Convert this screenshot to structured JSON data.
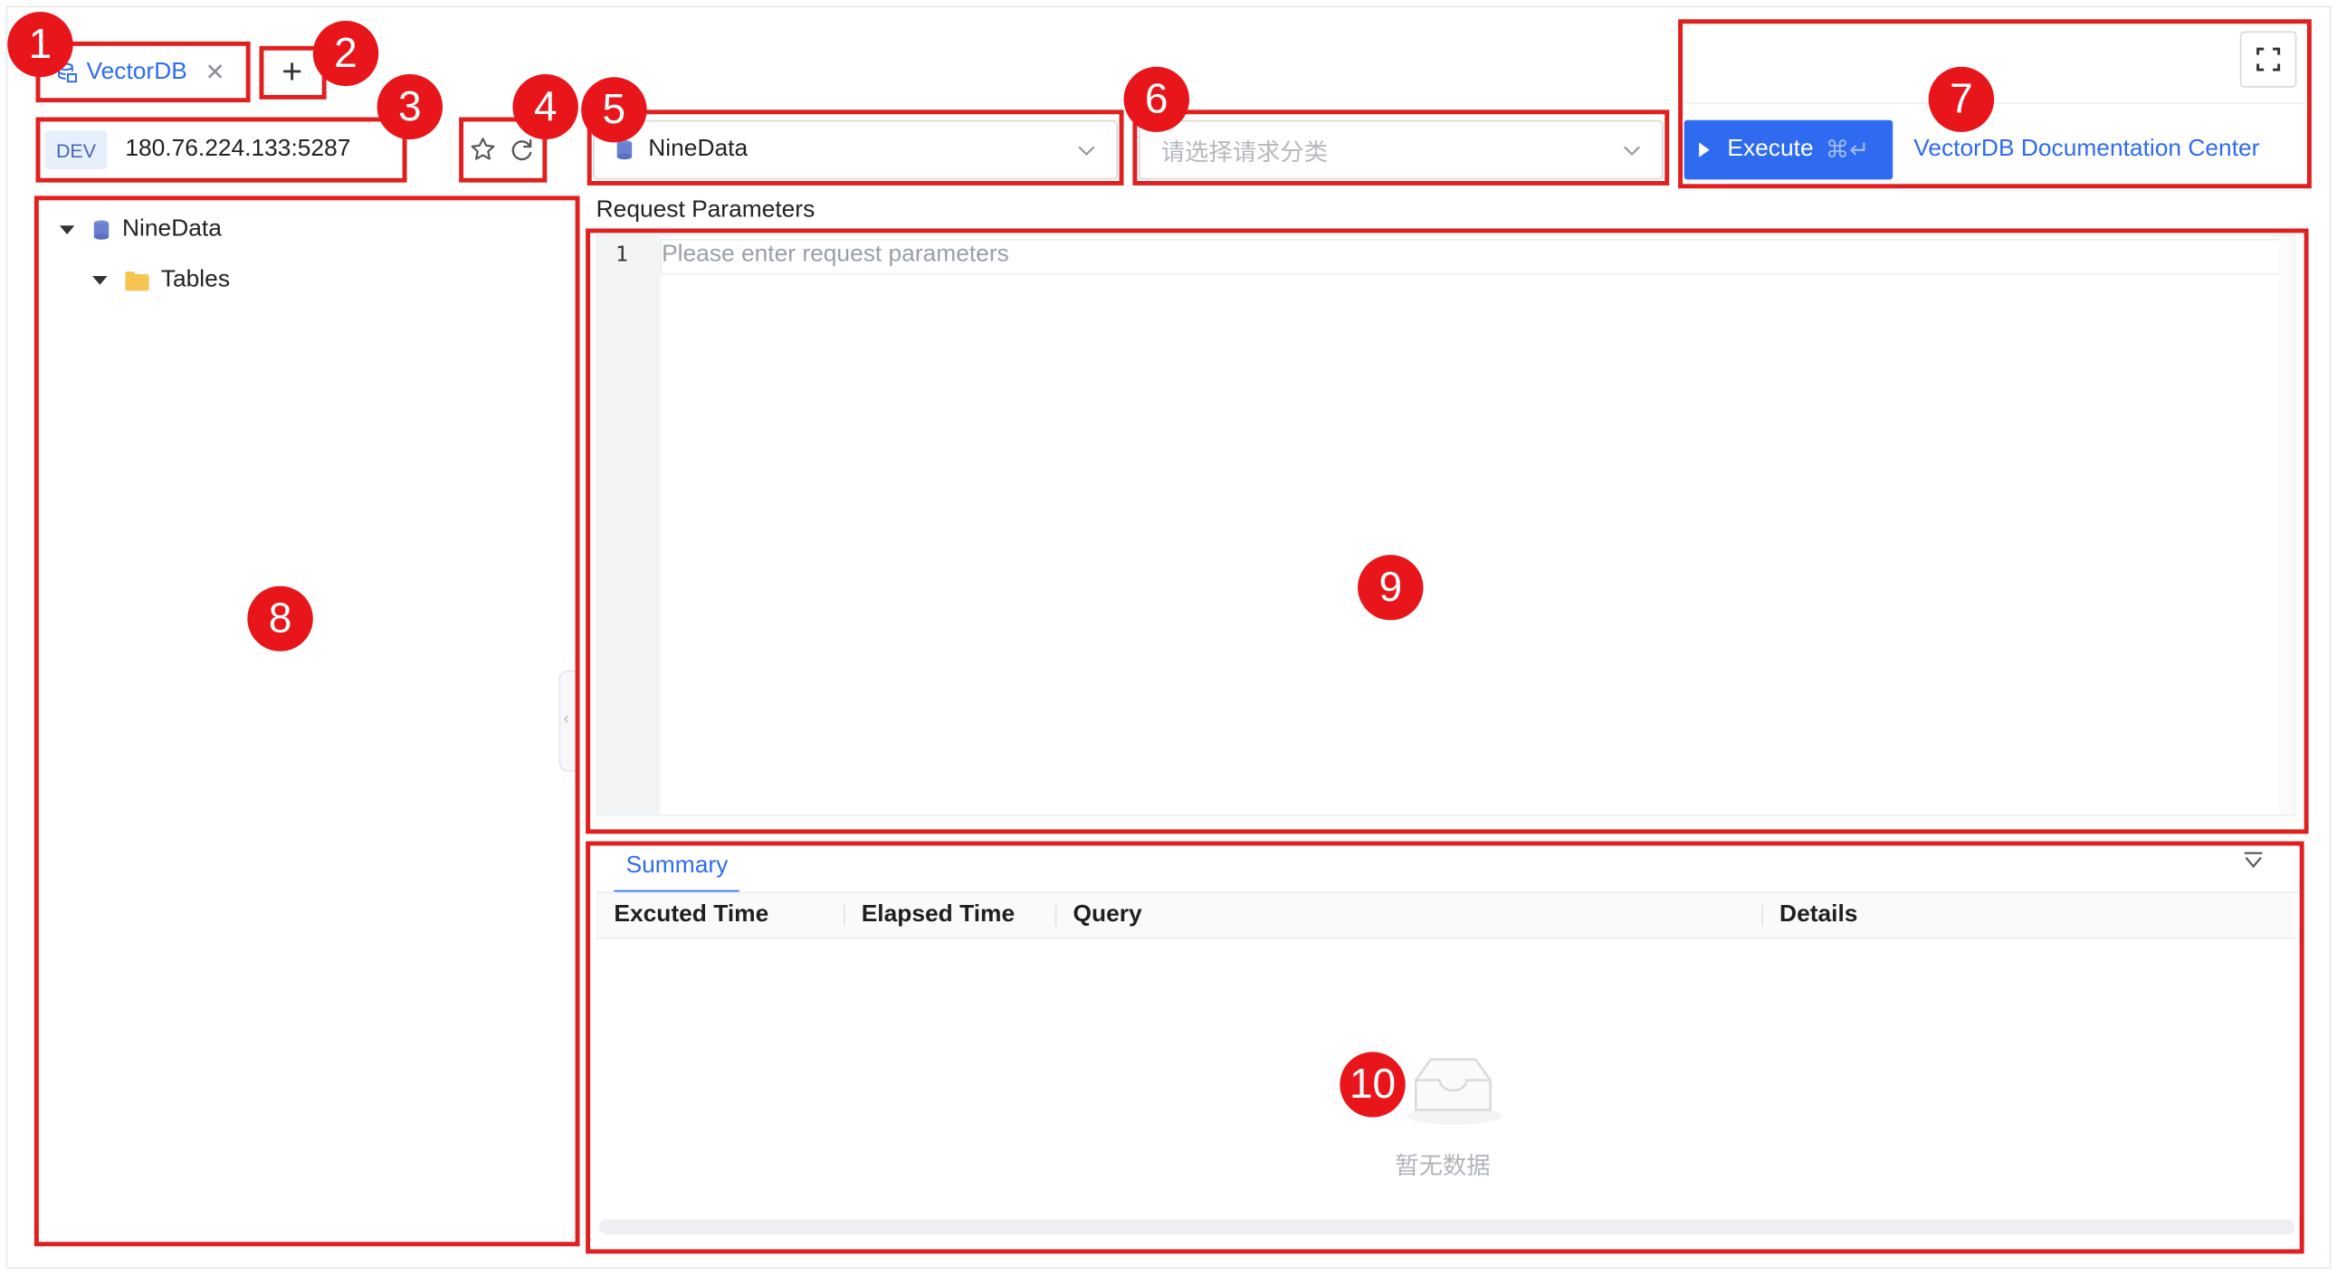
{
  "tab": {
    "label": "VectorDB"
  },
  "connection": {
    "env": "DEV",
    "address": "180.76.224.133:5287"
  },
  "selects": {
    "database": "NineData",
    "category_placeholder": "请选择请求分类"
  },
  "toolbar": {
    "execute_label": "Execute",
    "execute_shortcut": "⌘↵",
    "docs_link": "VectorDB Documentation Center"
  },
  "tree": {
    "root": "NineData",
    "child": "Tables"
  },
  "editor": {
    "label": "Request Parameters",
    "line_number": "1",
    "placeholder": "Please enter request parameters"
  },
  "results": {
    "tab": "Summary",
    "columns": [
      "Excuted Time",
      "Elapsed Time",
      "Query",
      "Details"
    ],
    "empty_text": "暂无数据"
  },
  "annotations": [
    "1",
    "2",
    "3",
    "4",
    "5",
    "6",
    "7",
    "8",
    "9",
    "10"
  ],
  "colors": {
    "accent": "#2f6bf0",
    "annotation": "#e02020"
  }
}
